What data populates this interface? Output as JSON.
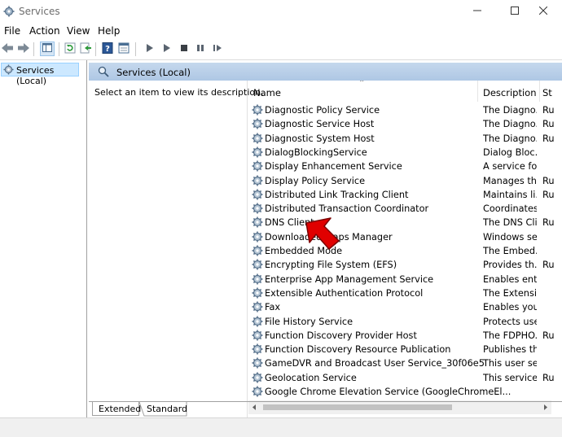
{
  "window": {
    "title": "Services"
  },
  "menu": [
    "File",
    "Action",
    "View",
    "Help"
  ],
  "tree": {
    "root_label": "Services (Local)"
  },
  "pane": {
    "header": "Services (Local)",
    "description": "Select an item to view its description."
  },
  "columns": {
    "name": "Name",
    "description": "Description",
    "status": "St"
  },
  "services": [
    {
      "name": "Diagnostic Policy Service",
      "description": "The Diagno...",
      "status": "Ru"
    },
    {
      "name": "Diagnostic Service Host",
      "description": "The Diagno...",
      "status": "Ru"
    },
    {
      "name": "Diagnostic System Host",
      "description": "The Diagno...",
      "status": "Ru"
    },
    {
      "name": "DialogBlockingService",
      "description": "Dialog Bloc...",
      "status": ""
    },
    {
      "name": "Display Enhancement Service",
      "description": "A service fo...",
      "status": ""
    },
    {
      "name": "Display Policy Service",
      "description": "Manages th...",
      "status": "Ru"
    },
    {
      "name": "Distributed Link Tracking Client",
      "description": "Maintains li...",
      "status": "Ru"
    },
    {
      "name": "Distributed Transaction Coordinator",
      "description": "Coordinates...",
      "status": ""
    },
    {
      "name": "DNS Client",
      "description": "The DNS Cli...",
      "status": "Ru"
    },
    {
      "name": "Downloaded Maps Manager",
      "description": "Windows se...",
      "status": ""
    },
    {
      "name": "Embedded Mode",
      "description": "The Embed...",
      "status": ""
    },
    {
      "name": "Encrypting File System (EFS)",
      "description": "Provides th...",
      "status": "Ru"
    },
    {
      "name": "Enterprise App Management Service",
      "description": "Enables ent...",
      "status": ""
    },
    {
      "name": "Extensible Authentication Protocol",
      "description": "The Extensi...",
      "status": ""
    },
    {
      "name": "Fax",
      "description": "Enables you...",
      "status": ""
    },
    {
      "name": "File History Service",
      "description": "Protects use...",
      "status": ""
    },
    {
      "name": "Function Discovery Provider Host",
      "description": "The FDPHO...",
      "status": "Ru"
    },
    {
      "name": "Function Discovery Resource Publication",
      "description": "Publishes th...",
      "status": ""
    },
    {
      "name": "GameDVR and Broadcast User Service_30f06e5",
      "description": "This user se...",
      "status": ""
    },
    {
      "name": "Geolocation Service",
      "description": "This service ...",
      "status": "Ru"
    },
    {
      "name": "Google Chrome Elevation Service (GoogleChromeEl...",
      "description": "",
      "status": ""
    }
  ],
  "tabs": [
    "Extended",
    "Standard"
  ],
  "colors": {
    "pane_header": "#b9d1ea",
    "selection": "#cce8ff",
    "pointer": "#e00000"
  },
  "icons": [
    "services-icon",
    "minimize-icon",
    "maximize-icon",
    "close-icon",
    "back-icon",
    "forward-icon",
    "show-hide-tree-icon",
    "refresh-icon",
    "export-list-icon",
    "help-icon",
    "properties-icon",
    "start-icon",
    "start-alt-icon",
    "stop-icon",
    "pause-icon",
    "restart-icon",
    "gear-icon",
    "pointer-arrow-icon"
  ]
}
